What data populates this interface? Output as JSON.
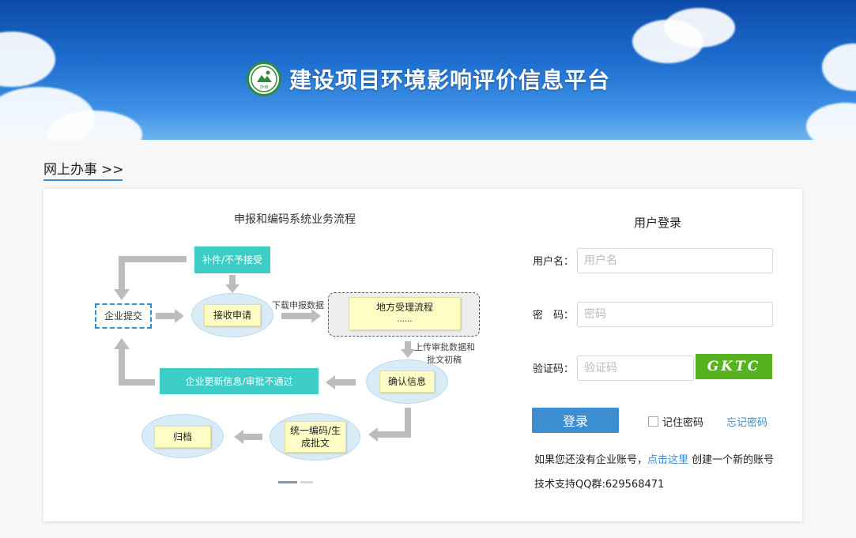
{
  "header": {
    "site_title": "建设项目环境影响评价信息平台",
    "logo_text": "ZHB"
  },
  "section": {
    "heading": "网上办事",
    "heading_suffix": ">>"
  },
  "flow": {
    "title": "申报和编码系统业务流程",
    "nodes": {
      "supplement": "补件/不予接受",
      "enterprise_submit": "企业提交",
      "receive": "接收申请",
      "local_process": "地方受理流程",
      "local_process_sub": "......",
      "confirm": "确认信息",
      "update_info": "企业更新信息/审批不通过",
      "coding": "统一编码/生\n成批文",
      "archive": "归档"
    },
    "edge_labels": {
      "download": "下载申报数据",
      "upload_line1": "上传审批数据和",
      "upload_line2": "批文初稿"
    }
  },
  "login": {
    "title": "用户登录",
    "username_label": "用户名：",
    "username_placeholder": "用户名",
    "password_label": "密　码：",
    "password_placeholder": "密码",
    "captcha_label": "验证码：",
    "captcha_placeholder": "验证码",
    "captcha_text": "GKTC",
    "submit_label": "登录",
    "remember_label": "记住密码",
    "forgot_label": "忘记密码",
    "register_prefix": "如果您还没有企业账号，",
    "register_link": "点击这里",
    "register_suffix": " 创建一个新的账号",
    "support": "技术支持QQ群:629568471"
  },
  "colors": {
    "accent": "#3c8ed1",
    "captcha_bg": "#56b31f",
    "teal": "#3ecdc6",
    "header_dark": "#0c4aa8"
  }
}
